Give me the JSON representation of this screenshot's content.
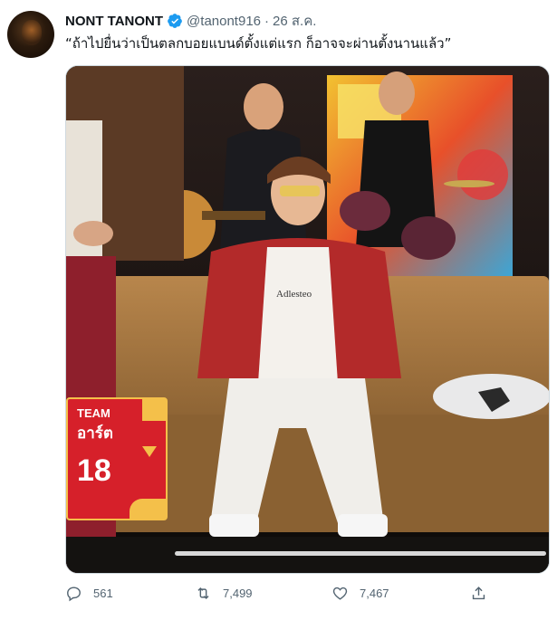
{
  "author": {
    "name": "NONT TANONT",
    "handle": "@tanont916",
    "date": "26 ส.ค."
  },
  "tweet": {
    "text": "“ถ้าไปยื่นว่าเป็นตลกบอยแบนด์ตั้งแต่แรก ก็อาจจะผ่านตั้งนานแล้ว”"
  },
  "media": {
    "overlay_team": "TEAM",
    "overlay_name": "อาร์ต",
    "overlay_score": "18",
    "shirt_text": "Adlesteo"
  },
  "actions": {
    "replies": "561",
    "retweets": "7,499",
    "likes": "7,467"
  },
  "icons": {
    "verified": "verified-badge-icon",
    "reply": "reply-icon",
    "retweet": "retweet-icon",
    "like": "heart-icon",
    "share": "share-icon"
  },
  "colors": {
    "verified": "#1d9bf0",
    "text_secondary": "#536471",
    "overlay_red": "#d6202a"
  }
}
